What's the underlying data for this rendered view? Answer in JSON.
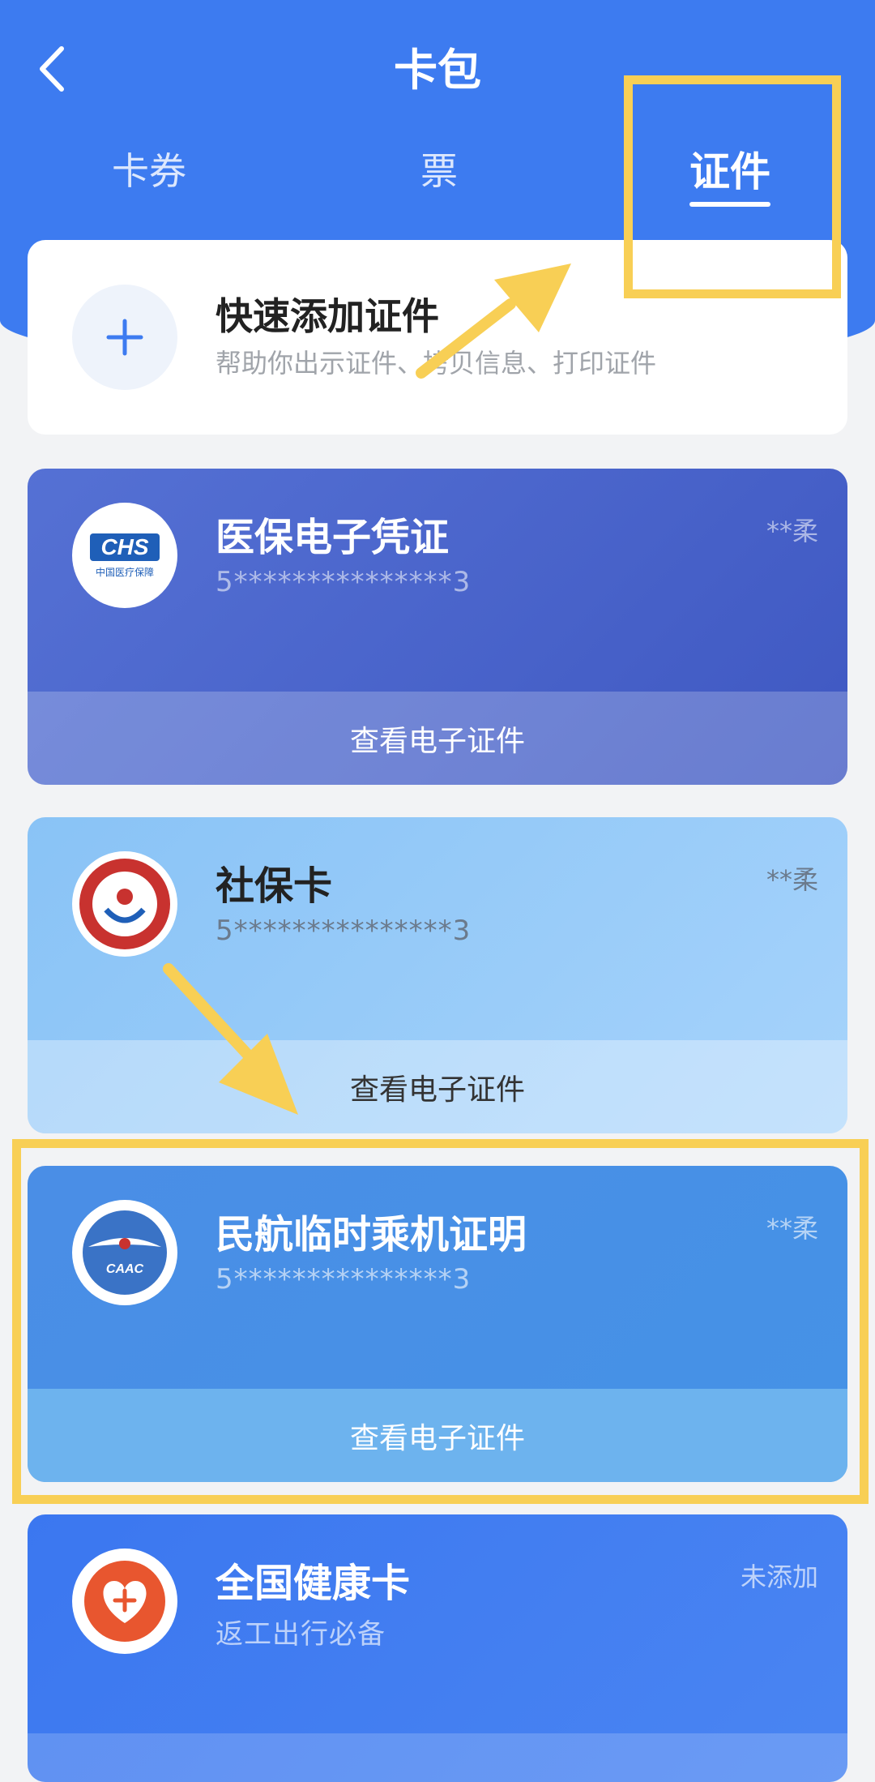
{
  "header": {
    "title": "卡包",
    "tabs": [
      {
        "label": "卡券"
      },
      {
        "label": "票"
      },
      {
        "label": "证件"
      }
    ]
  },
  "quick_add": {
    "title": "快速添加证件",
    "subtitle": "帮助你出示证件、拷贝信息、打印证件"
  },
  "cards": [
    {
      "name": "医保电子凭证",
      "number": "5***************3",
      "holder": "**柔",
      "action": "查看电子证件",
      "logo_text": "CHS",
      "logo_sub": "中国医疗保障"
    },
    {
      "name": "社保卡",
      "number": "5***************3",
      "holder": "**柔",
      "action": "查看电子证件"
    },
    {
      "name": "民航临时乘机证明",
      "number": "5***************3",
      "holder": "**柔",
      "action": "查看电子证件",
      "logo_text": "CAAC"
    },
    {
      "name": "全国健康卡",
      "subtitle": "返工出行必备",
      "status": "未添加"
    }
  ],
  "colors": {
    "brand_blue": "#3d7bf0",
    "highlight": "#f8cf55"
  }
}
